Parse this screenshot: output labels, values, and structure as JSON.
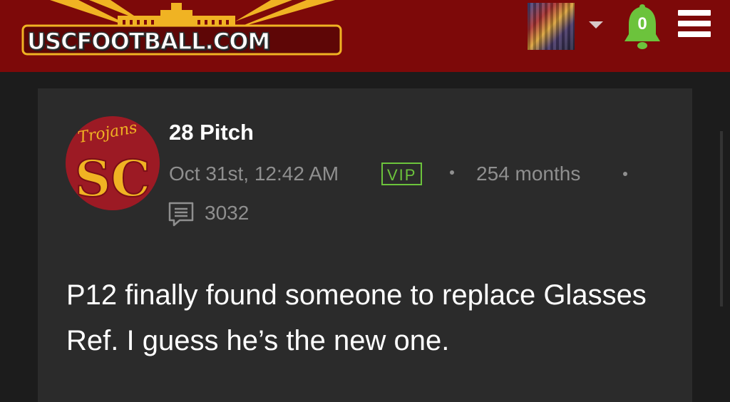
{
  "header": {
    "logo_text": "USCFOOTBALL.COM",
    "notification_count": "0",
    "colors": {
      "brand": "#7d0909",
      "bell": "#6cc33c",
      "logo_gold": "#f0b323"
    }
  },
  "post": {
    "avatar_script": "Trojans",
    "avatar_monogram": "SC",
    "username": "28 Pitch",
    "date": "Oct 31st, 12:42 AM",
    "badge": "VIP",
    "tenure": "254 months",
    "comment_count": "3032",
    "body": "P12 finally found someone to replace Glasses Ref. I guess he’s the new one."
  },
  "icons": [
    "logo",
    "user-avatar-icon",
    "dropdown-caret-icon",
    "bell-icon",
    "hamburger-menu-icon",
    "comment-icon"
  ]
}
